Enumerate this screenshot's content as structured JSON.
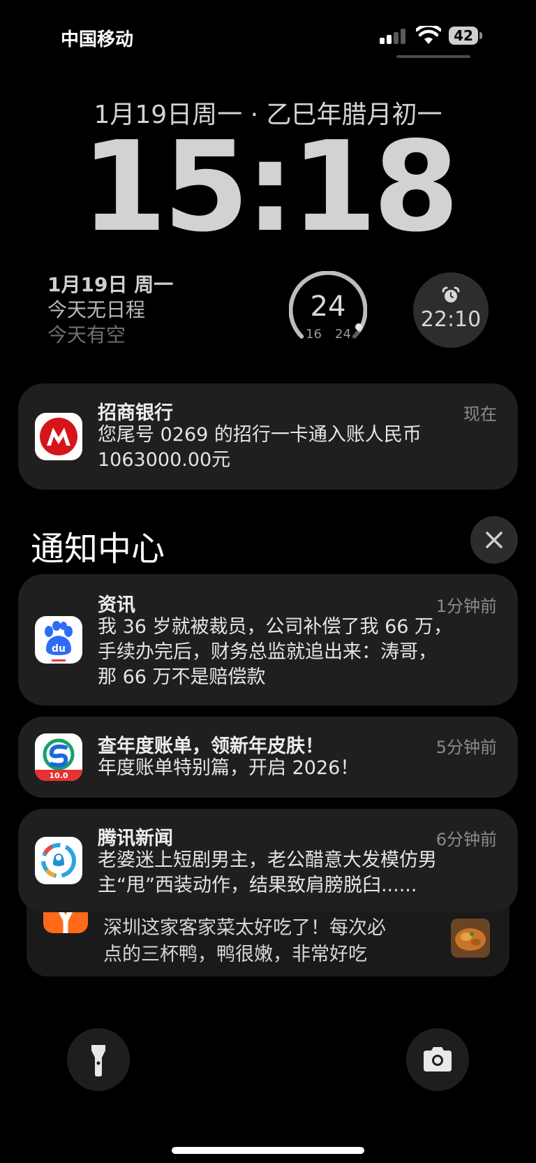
{
  "status_bar": {
    "carrier": "中国移动",
    "battery_level": "42"
  },
  "lock_screen": {
    "date_line": "1月19日周一 · 乙巳年腊月初一",
    "time": "15:18"
  },
  "widgets": {
    "calendar": {
      "date": "1月19日 周一",
      "events": "今天无日程",
      "status": "今天有空"
    },
    "weather": {
      "current": "24",
      "low": "16",
      "high": "24"
    },
    "alarm": {
      "time": "22:10"
    }
  },
  "banner_notification": {
    "app": "招商银行",
    "when": "现在",
    "line1": "您尾号 0269 的招行一卡通入账人民币",
    "line2": "1063000.00元"
  },
  "notification_center": {
    "title": "通知中心",
    "items": [
      {
        "title": "资讯",
        "when": "1分钟前",
        "lines": [
          "我 36 岁就被裁员，公司补偿了我 66 万，",
          "手续办完后，财务总监就追出来：涛哥，",
          "那 66 万不是赔偿款"
        ]
      },
      {
        "title": "查年度账单，领新年皮肤！",
        "when": "5分钟前",
        "lines": [
          "年度账单特别篇，开启 2026！"
        ]
      },
      {
        "title": "腾讯新闻",
        "when": "6分钟前",
        "lines": [
          "老婆迷上短剧男主，老公醋意大发模仿男",
          "主“甩”西装动作，结果致肩膀脱臼......"
        ]
      }
    ],
    "stacked": {
      "lines": [
        "深圳这家客家菜太好吃了！每次必",
        "点的三杯鸭，鸭很嫩，非常好吃"
      ]
    }
  },
  "colors": {
    "background": "#000000",
    "card": "#1f1f1f",
    "cmb_red": "#d7141a",
    "baidu_blue": "#2d6cf5",
    "metro_green": "#1aa06b",
    "meituan_orange": "#ff6a1a"
  },
  "icons": {
    "flashlight": "flashlight-icon",
    "camera": "camera-icon",
    "close": "close-icon"
  }
}
